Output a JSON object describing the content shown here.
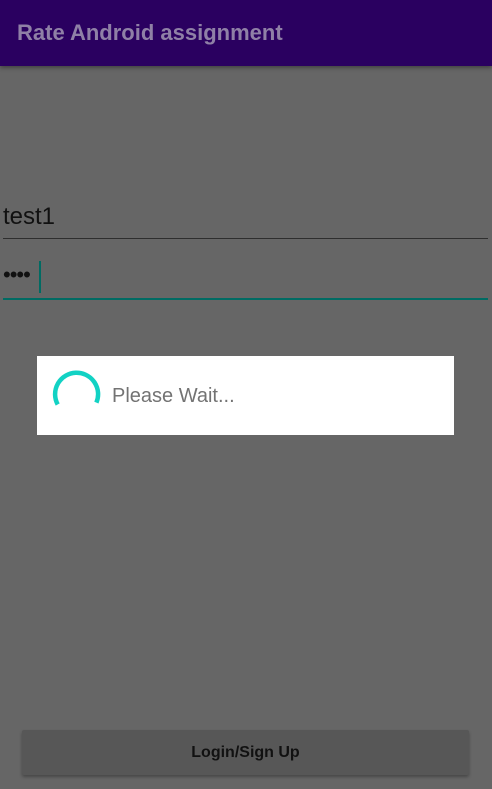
{
  "app_bar": {
    "title": "Rate Android assignment",
    "background": "#2a0060"
  },
  "form": {
    "username_value": "test1",
    "password_value": "••••",
    "accent_color": "#006b63"
  },
  "progress_dialog": {
    "message": "Please Wait...",
    "spinner_icon": "circular-progress-icon",
    "spinner_color": "#12d2c4"
  },
  "login_button": {
    "label": "Login/Sign Up"
  }
}
